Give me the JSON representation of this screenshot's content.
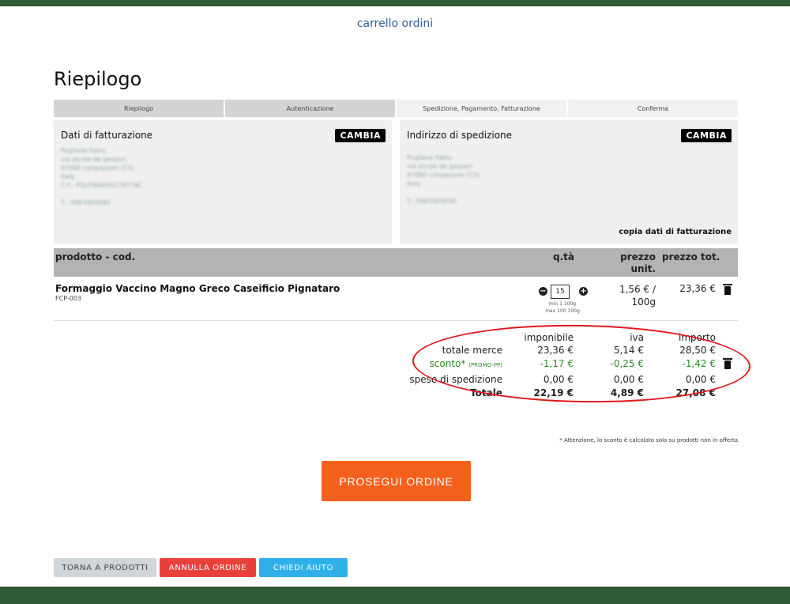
{
  "header": {
    "title": "carrello ordini"
  },
  "page_title": "Riepilogo",
  "steps": [
    "Riepilogo",
    "Autenticazione",
    "Spedizione, Pagamento, Fatturazione",
    "Conferma"
  ],
  "billing": {
    "title": "Dati di fatturazione",
    "change_label": "CAMBIA",
    "lines": [
      "Pugliese Fabio",
      "via alcide de gasperi",
      "87060 calopezzati (CS)",
      "Italy",
      "C.F.: PGLFBA80H17B774C",
      "T.: 0983909090"
    ]
  },
  "shipping": {
    "title": "Indirizzo di spedizione",
    "change_label": "CAMBIA",
    "lines": [
      "Pugliese Fabio",
      "via alcide de gasperi",
      "87060 calopezzati (CS)",
      "Italy",
      "T.: 0983909090"
    ],
    "copy_label": "copia dati di fatturazione"
  },
  "table_header": {
    "product": "prodotto - cod.",
    "qty": "q.tà",
    "unit_price_1": "prezzo",
    "unit_price_2": "unit.",
    "total_price": "prezzo tot."
  },
  "product": {
    "name": "Formaggio Vaccino Magno Greco Caseificio Pignataro",
    "code": "FCP-003",
    "qty": "15",
    "qty_min": "min 1 100g",
    "qty_max": "max 100 100g",
    "unit_price_1": "1,56 € /",
    "unit_price_2": "100g",
    "total": "23,36 €"
  },
  "summary": {
    "col_imponibile": "imponibile",
    "col_iva": "iva",
    "col_importo": "importo",
    "rows": [
      {
        "label": "totale merce",
        "tag": "",
        "imponibile": "23,36 €",
        "iva": "5,14 €",
        "importo": "28,50 €"
      },
      {
        "label": "sconto*",
        "tag": "(PROMO-PP)",
        "imponibile": "-1,17 €",
        "iva": "-0,25 €",
        "importo": "-1,42 €"
      },
      {
        "label": "spese di spedizione",
        "tag": "",
        "imponibile": "0,00 €",
        "iva": "0,00 €",
        "importo": "0,00 €"
      },
      {
        "label": "Totale",
        "tag": "",
        "imponibile": "22,19 €",
        "iva": "4,89 €",
        "importo": "27,08 €"
      }
    ],
    "note": "* Attenzione, lo sconto è calcolato solo su prodotti non in offerta"
  },
  "actions": {
    "proceed": "PROSEGUI ORDINE",
    "back": "TORNA A PRODOTTI",
    "cancel": "ANNULLA ORDINE",
    "help": "CHIEDI AIUTO"
  },
  "colors": {
    "brand_green": "#2f5a34",
    "accent_orange": "#f4611d",
    "cancel_red": "#e8413c",
    "help_blue": "#2fb0ea",
    "discount_green": "#2a8a2a",
    "annotation_red": "#e2161e"
  }
}
